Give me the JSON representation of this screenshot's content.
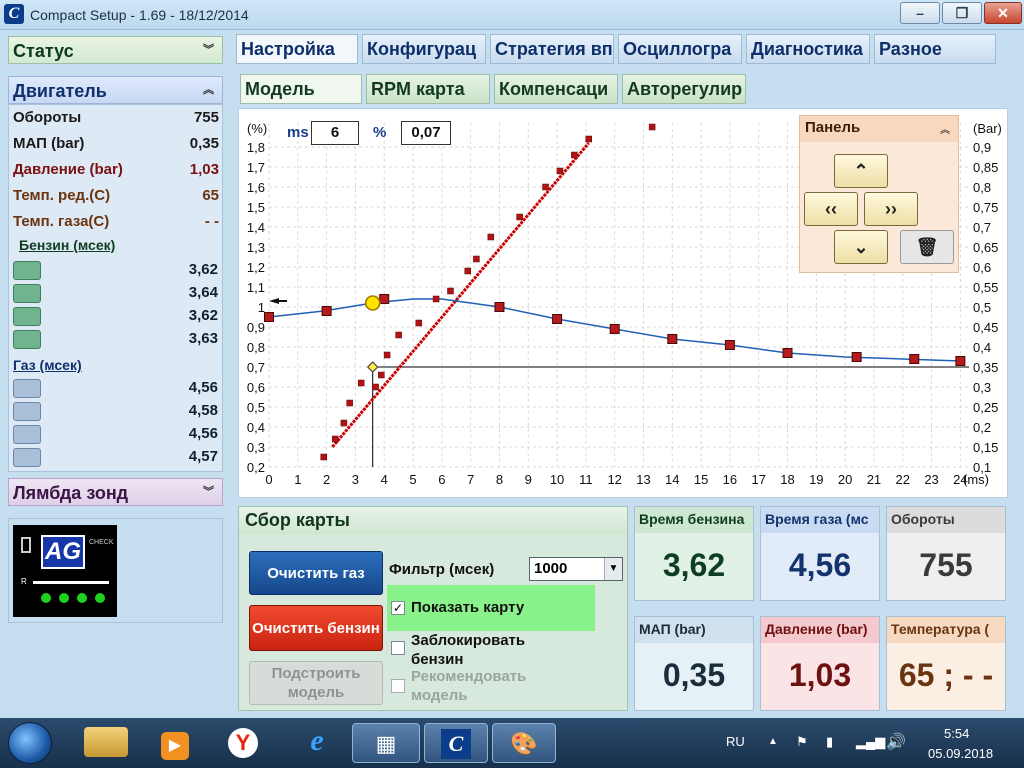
{
  "window": {
    "title": "Compact Setup - 1.69 - 18/12/2014",
    "app_icon": "C"
  },
  "left": {
    "status_label": "Статус",
    "engine_label": "Двигатель",
    "rows": [
      {
        "key": "Обороты",
        "value": "755",
        "color": "#1a1a1a"
      },
      {
        "key": "МАП (bar)",
        "value": "0,35",
        "color": "#1a1a1a"
      },
      {
        "key": "Давление (bar)",
        "value": "1,03",
        "color": "#7a1010"
      },
      {
        "key": "Темп. ред.(С)",
        "value": "65",
        "color": "#6a3410"
      },
      {
        "key": "Темп. газа(С)",
        "value": "- -",
        "color": "#6a3410"
      }
    ],
    "petrol_label": "Бензин (мсек)",
    "petrol_values": [
      "3,62",
      "3,64",
      "3,62",
      "3,63"
    ],
    "gas_label": "Газ (мсек)",
    "gas_values": [
      "4,56",
      "4,58",
      "4,56",
      "4,57"
    ],
    "lambda_label": "Лямбда зонд",
    "logo_text": "AG",
    "logo_check": "CHECK",
    "logo_r": "R"
  },
  "tabs": [
    "Настройка",
    "Конфигурац",
    "Стратегия вп",
    "Осциллогра",
    "Диагностика",
    "Разное"
  ],
  "subtabs": [
    "Модель",
    "RPM карта",
    "Компенсаци",
    "Авторегулир"
  ],
  "chart_controls": {
    "ms_label": "ms",
    "ms_value": "6",
    "pct_label": "%",
    "pct_value": "0,07",
    "left_unit": "(%)",
    "right_unit": "(Bar)",
    "x_unit": "(ms)",
    "panel_title": "Панель"
  },
  "chart_data": {
    "type": "scatter",
    "x_ticks": [
      0,
      1,
      2,
      3,
      4,
      5,
      6,
      7,
      8,
      9,
      10,
      11,
      12,
      13,
      14,
      15,
      16,
      17,
      18,
      19,
      20,
      21,
      22,
      23,
      24
    ],
    "xlim": [
      0,
      24.3
    ],
    "y_left_ticks": [
      "0,2",
      "0,3",
      "0,4",
      "0,5",
      "0,6",
      "0,7",
      "0,8",
      "0,9",
      "1",
      "1,1",
      "1,2",
      "1,3",
      "1,4",
      "1,5",
      "1,6",
      "1,7",
      "1,8"
    ],
    "ylim_left": [
      0.2,
      1.8
    ],
    "y_right_ticks": [
      "0,1",
      "0,15",
      "0,2",
      "0,25",
      "0,3",
      "0,35",
      "0,4",
      "0,45",
      "0,5",
      "0,55",
      "0,6",
      "0,65",
      "0,7",
      "0,75",
      "0,8",
      "0,85",
      "0,9"
    ],
    "ylim_right": [
      0.1,
      0.9
    ],
    "model_curve": {
      "name": "model",
      "color": "#1f5fb5",
      "points": [
        [
          0,
          0.95
        ],
        [
          1.9,
          0.98
        ],
        [
          3.6,
          1.02
        ],
        [
          5,
          1.04
        ],
        [
          6,
          1.04
        ],
        [
          8,
          1.0
        ],
        [
          10,
          0.94
        ],
        [
          12,
          0.89
        ],
        [
          14,
          0.84
        ],
        [
          16,
          0.81
        ],
        [
          18,
          0.77
        ],
        [
          20,
          0.75
        ],
        [
          22,
          0.74
        ],
        [
          24,
          0.73
        ]
      ]
    },
    "model_nodes": [
      [
        0,
        0.95
      ],
      [
        2,
        0.98
      ],
      [
        4,
        1.04
      ],
      [
        8,
        1.0
      ],
      [
        10,
        0.94
      ],
      [
        12,
        0.89
      ],
      [
        14,
        0.84
      ],
      [
        16,
        0.81
      ],
      [
        18,
        0.77
      ],
      [
        20.4,
        0.75
      ],
      [
        22.4,
        0.74
      ],
      [
        24,
        0.73
      ]
    ],
    "petrol_scatter": [
      [
        1.9,
        0.25
      ],
      [
        2.3,
        0.34
      ],
      [
        2.6,
        0.42
      ],
      [
        2.8,
        0.52
      ],
      [
        3.2,
        0.62
      ],
      [
        3.7,
        0.6
      ],
      [
        3.9,
        0.66
      ],
      [
        4.1,
        0.76
      ],
      [
        4.5,
        0.86
      ],
      [
        5.2,
        0.92
      ],
      [
        5.8,
        1.04
      ],
      [
        6.3,
        1.08
      ],
      [
        6.9,
        1.18
      ],
      [
        7.2,
        1.24
      ],
      [
        7.7,
        1.35
      ],
      [
        8.7,
        1.45
      ],
      [
        9.6,
        1.6
      ],
      [
        10.1,
        1.68
      ],
      [
        10.6,
        1.76
      ],
      [
        11.1,
        1.84
      ],
      [
        13.3,
        2.02
      ]
    ],
    "fit_line": {
      "from": [
        2.2,
        0.3
      ],
      "to": [
        11.1,
        1.82
      ],
      "color": "#cc0000"
    },
    "crosshair": {
      "x": 3.6,
      "y": 0.7
    },
    "cursor_point": {
      "x": 3.6,
      "y": 1.02
    },
    "left_marker_y": 1.03
  },
  "panel_buttons": {
    "up": "⌃",
    "left": "‹‹",
    "right": "››",
    "down": "⌄",
    "trash": "🗑"
  },
  "bottom": {
    "title": "Сбор карты",
    "clear_gas": "Очистить газ",
    "clear_petrol": "Очистить бензин",
    "build_model": "Подстроить модель",
    "filter_label": "Фильтр (мсек)",
    "filter_value": "1000",
    "show_map": "Показать карту",
    "lock_petrol": "Заблокировать бензин",
    "recommend_model": "Рекомендовать модель"
  },
  "cards": [
    {
      "title": "Время бензина",
      "value": "3,62",
      "bg": "#e2f1e5",
      "hd": "#cde7d3",
      "fg": "#0f3d22"
    },
    {
      "title": "Время газа (мс",
      "value": "4,56",
      "bg": "#e2ecf8",
      "hd": "#c8dbf2",
      "fg": "#13336e"
    },
    {
      "title": "Обороты",
      "value": "755",
      "bg": "#efefef",
      "hd": "#dcdcdc",
      "fg": "#3a3a3a"
    },
    {
      "title": "МАП (bar)",
      "value": "0,35",
      "bg": "#e6f0f7",
      "hd": "#cfe0ee",
      "fg": "#1b2c3a"
    },
    {
      "title": "Давление (bar)",
      "value": "1,03",
      "bg": "#fae4e6",
      "hd": "#f4c9cd",
      "fg": "#6d1010"
    },
    {
      "title": "Температура (",
      "value": "65 ;  - -",
      "bg": "#fbeee2",
      "hd": "#f5d9c0",
      "fg": "#6a3410"
    }
  ],
  "taskbar": {
    "lang": "RU",
    "time": "5:54",
    "date": "05.09.2018"
  }
}
